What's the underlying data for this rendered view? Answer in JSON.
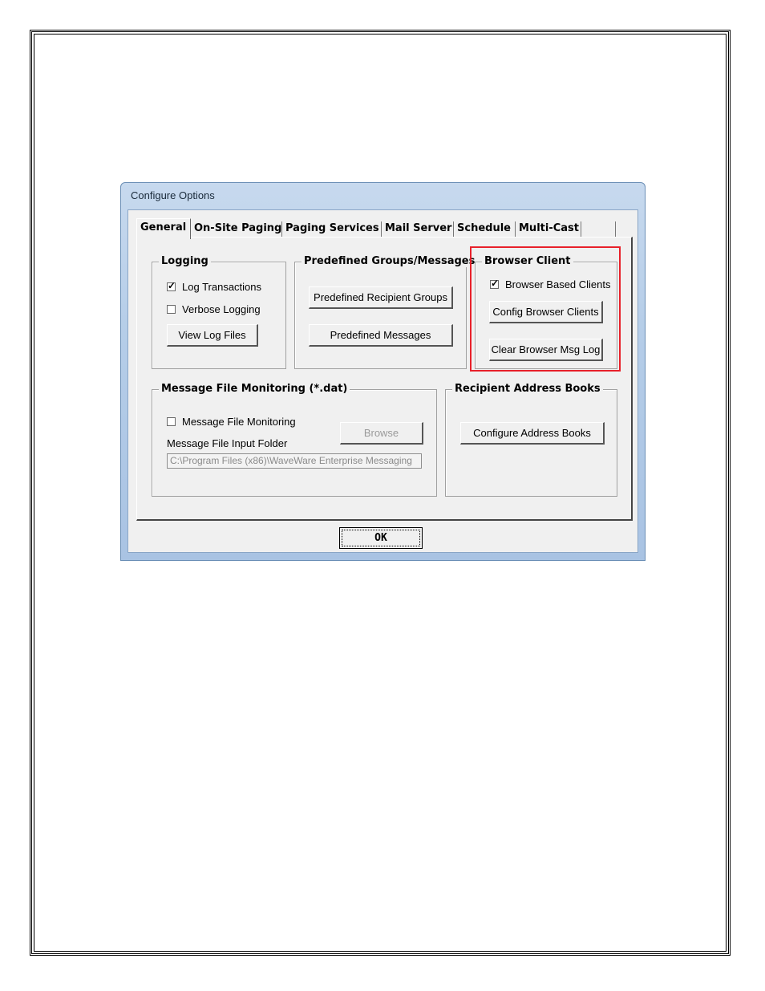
{
  "window": {
    "title": "Configure Options"
  },
  "tabs": [
    "General",
    "On-Site Paging",
    "Paging Services",
    "Mail Server",
    "Schedule",
    "Multi-Cast",
    ""
  ],
  "logging": {
    "label": "Logging",
    "log_transactions": {
      "label": "Log Transactions",
      "checked": true
    },
    "verbose_logging": {
      "label": "Verbose Logging",
      "checked": false
    },
    "view_button": "View Log Files"
  },
  "predefined": {
    "label": "Predefined Groups/Messages",
    "groups_button": "Predefined Recipient Groups",
    "messages_button": "Predefined Messages"
  },
  "browser_client": {
    "label": "Browser Client",
    "browser_clients": {
      "label": "Browser Based Clients",
      "checked": true
    },
    "config_button": "Config Browser Clients",
    "clear_button": "Clear Browser Msg Log",
    "highlight_color": "#e8202a"
  },
  "monitoring": {
    "label": "Message File Monitoring (*.dat)",
    "monitoring_checkbox": {
      "label": "Message File Monitoring",
      "checked": false
    },
    "browse_button": "Browse",
    "folder_label": "Message File Input Folder",
    "folder_value": "C:\\Program Files (x86)\\WaveWare Enterprise Messaging"
  },
  "address_books": {
    "label": "Recipient Address Books",
    "configure_button": "Configure Address Books"
  },
  "ok_button": "OK"
}
